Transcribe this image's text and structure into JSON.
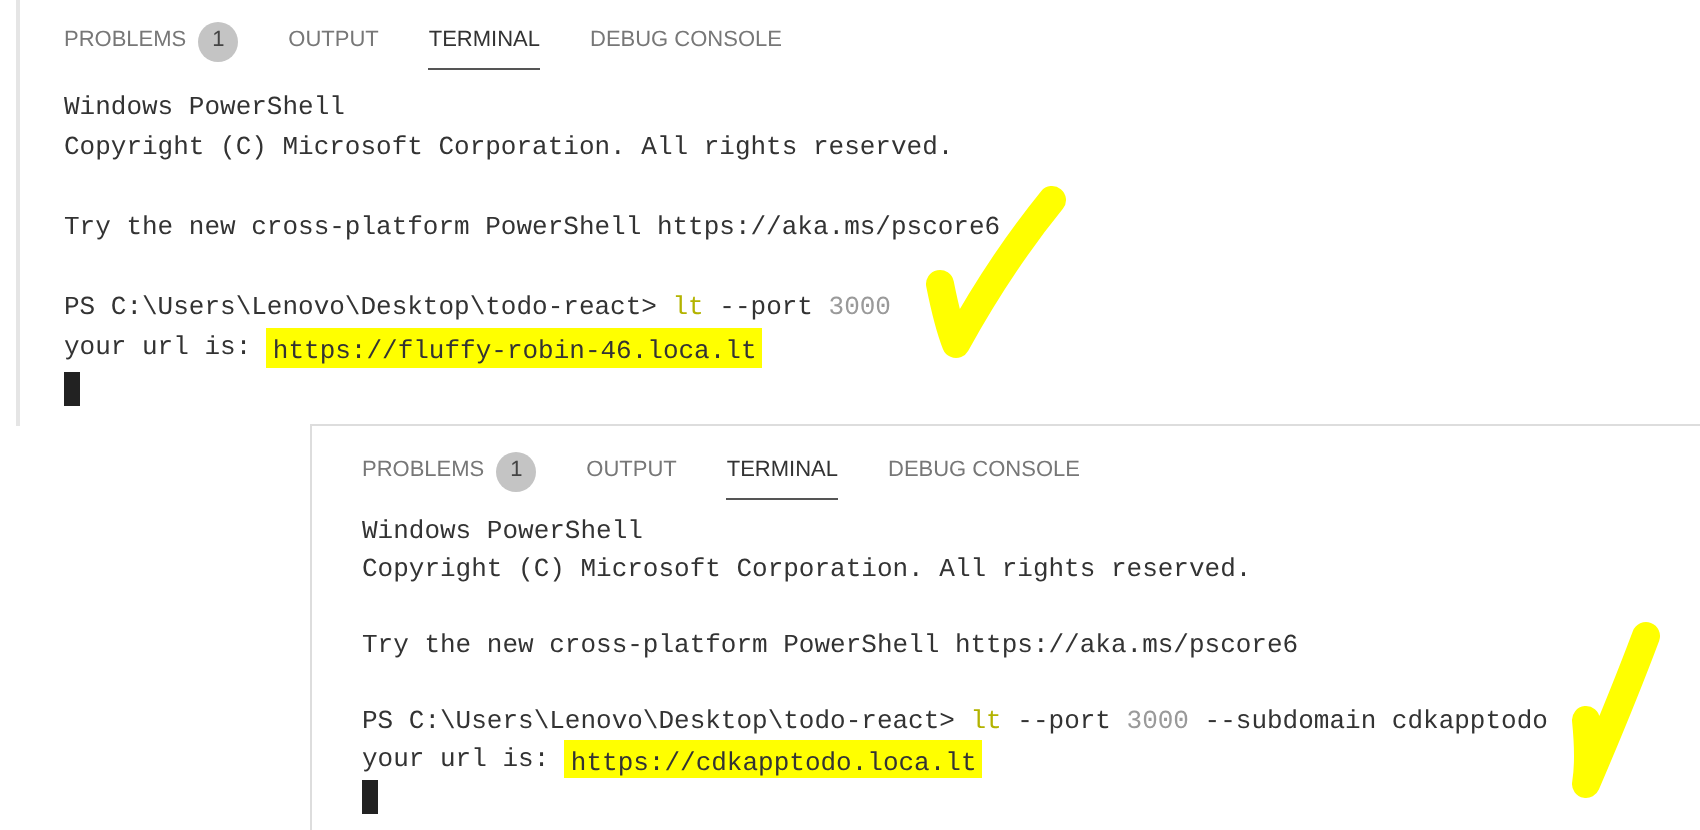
{
  "panels": [
    {
      "tabs": [
        {
          "label": "PROBLEMS",
          "badge": "1",
          "selected": false
        },
        {
          "label": "OUTPUT",
          "selected": false
        },
        {
          "label": "TERMINAL",
          "selected": true
        },
        {
          "label": "DEBUG CONSOLE",
          "selected": false
        }
      ],
      "lines": [
        {
          "kind": "text",
          "segments": [
            {
              "kind": "plain",
              "text": "Windows PowerShell"
            }
          ]
        },
        {
          "kind": "text",
          "segments": [
            {
              "kind": "plain",
              "text": "Copyright (C) Microsoft Corporation. All rights reserved."
            }
          ]
        },
        {
          "kind": "blank"
        },
        {
          "kind": "text",
          "segments": [
            {
              "kind": "plain",
              "text": "Try the new cross-platform PowerShell https://aka.ms/pscore6"
            }
          ]
        },
        {
          "kind": "blank"
        },
        {
          "kind": "text",
          "segments": [
            {
              "kind": "plain",
              "text": "PS C:\\Users\\Lenovo\\Desktop\\todo-react> "
            },
            {
              "kind": "command",
              "text": "lt"
            },
            {
              "kind": "plain",
              "text": " --port "
            },
            {
              "kind": "number",
              "text": "3000"
            }
          ]
        },
        {
          "kind": "text",
          "segments": [
            {
              "kind": "plain",
              "text": "your url is: "
            },
            {
              "kind": "highlighted",
              "text": "https://fluffy-robin-46.loca.lt"
            }
          ]
        },
        {
          "kind": "cursor"
        }
      ],
      "checkmark": true
    },
    {
      "tabs": [
        {
          "label": "PROBLEMS",
          "badge": "1",
          "selected": false
        },
        {
          "label": "OUTPUT",
          "selected": false
        },
        {
          "label": "TERMINAL",
          "selected": true
        },
        {
          "label": "DEBUG CONSOLE",
          "selected": false
        }
      ],
      "lines": [
        {
          "kind": "text",
          "segments": [
            {
              "kind": "plain",
              "text": "Windows PowerShell"
            }
          ]
        },
        {
          "kind": "text",
          "segments": [
            {
              "kind": "plain",
              "text": "Copyright (C) Microsoft Corporation. All rights reserved."
            }
          ]
        },
        {
          "kind": "blank"
        },
        {
          "kind": "text",
          "segments": [
            {
              "kind": "plain",
              "text": "Try the new cross-platform PowerShell https://aka.ms/pscore6"
            }
          ]
        },
        {
          "kind": "blank"
        },
        {
          "kind": "text",
          "segments": [
            {
              "kind": "plain",
              "text": "PS C:\\Users\\Lenovo\\Desktop\\todo-react> "
            },
            {
              "kind": "command",
              "text": "lt"
            },
            {
              "kind": "plain",
              "text": " --port "
            },
            {
              "kind": "number",
              "text": "3000"
            },
            {
              "kind": "plain",
              "text": " --subdomain cdkapptodo"
            }
          ]
        },
        {
          "kind": "text",
          "segments": [
            {
              "kind": "plain",
              "text": "your url is: "
            },
            {
              "kind": "highlighted",
              "text": "https://cdkapptodo.loca.lt"
            }
          ]
        },
        {
          "kind": "cursor"
        }
      ],
      "checkmark": true
    }
  ]
}
